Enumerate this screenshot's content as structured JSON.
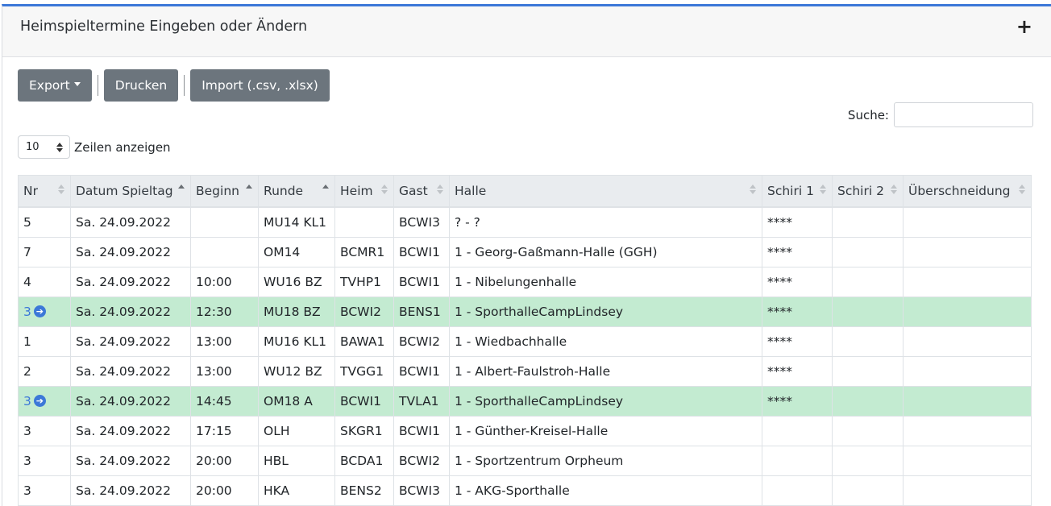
{
  "card": {
    "title": "Heimspieltermine Eingeben oder Ändern",
    "toggle_icon": "+"
  },
  "toolbar": {
    "export_label": "Export",
    "print_label": "Drucken",
    "import_label": "Import (.csv, .xlsx)"
  },
  "search": {
    "label": "Suche:",
    "value": ""
  },
  "length": {
    "value": "10",
    "label": "Zeilen anzeigen"
  },
  "accent_color": "#3c78d8",
  "highlight_color": "#c3ebd1",
  "table": {
    "headers": [
      "Nr",
      "Datum Spieltag",
      "Beginn",
      "Runde",
      "Heim",
      "Gast",
      "Halle",
      "Schiri 1",
      "Schiri 2",
      "Überschneidung"
    ],
    "rows": [
      {
        "nr": "5",
        "datum": "Sa. 24.09.2022",
        "beginn": "",
        "runde": "MU14 KL1",
        "heim": "",
        "gast": "BCWI3",
        "halle": "? - ?",
        "schiri1": "****",
        "schiri2": "",
        "ueber": "",
        "highlight": false
      },
      {
        "nr": "7",
        "datum": "Sa. 24.09.2022",
        "beginn": "",
        "runde": "OM14",
        "heim": "BCMR1",
        "gast": "BCWI1",
        "halle": "1 - Georg-Gaßmann-Halle (GGH)",
        "schiri1": "****",
        "schiri2": "",
        "ueber": "",
        "highlight": false
      },
      {
        "nr": "4",
        "datum": "Sa. 24.09.2022",
        "beginn": "10:00",
        "runde": "WU16 BZ",
        "heim": "TVHP1",
        "gast": "BCWI1",
        "halle": "1 - Nibelungenhalle",
        "schiri1": "****",
        "schiri2": "",
        "ueber": "",
        "highlight": false
      },
      {
        "nr": "3",
        "datum": "Sa. 24.09.2022",
        "beginn": "12:30",
        "runde": "MU18 BZ",
        "heim": "BCWI2",
        "gast": "BENS1",
        "halle": "1 - SporthalleCampLindsey",
        "schiri1": "****",
        "schiri2": "",
        "ueber": "",
        "highlight": true
      },
      {
        "nr": "1",
        "datum": "Sa. 24.09.2022",
        "beginn": "13:00",
        "runde": "MU16 KL1",
        "heim": "BAWA1",
        "gast": "BCWI2",
        "halle": "1 - Wiedbachhalle",
        "schiri1": "****",
        "schiri2": "",
        "ueber": "",
        "highlight": false
      },
      {
        "nr": "2",
        "datum": "Sa. 24.09.2022",
        "beginn": "13:00",
        "runde": "WU12 BZ",
        "heim": "TVGG1",
        "gast": "BCWI1",
        "halle": "1 - Albert-Faulstroh-Halle",
        "schiri1": "****",
        "schiri2": "",
        "ueber": "",
        "highlight": false
      },
      {
        "nr": "3",
        "datum": "Sa. 24.09.2022",
        "beginn": "14:45",
        "runde": "OM18 A",
        "heim": "BCWI1",
        "gast": "TVLA1",
        "halle": "1 - SporthalleCampLindsey",
        "schiri1": "****",
        "schiri2": "",
        "ueber": "",
        "highlight": true
      },
      {
        "nr": "3",
        "datum": "Sa. 24.09.2022",
        "beginn": "17:15",
        "runde": "OLH",
        "heim": "SKGR1",
        "gast": "BCWI1",
        "halle": "1 - Günther-Kreisel-Halle",
        "schiri1": "",
        "schiri2": "",
        "ueber": "",
        "highlight": false
      },
      {
        "nr": "3",
        "datum": "Sa. 24.09.2022",
        "beginn": "20:00",
        "runde": "HBL",
        "heim": "BCDA1",
        "gast": "BCWI2",
        "halle": "1 - Sportzentrum Orpheum",
        "schiri1": "",
        "schiri2": "",
        "ueber": "",
        "highlight": false
      },
      {
        "nr": "3",
        "datum": "Sa. 24.09.2022",
        "beginn": "20:00",
        "runde": "HKA",
        "heim": "BENS2",
        "gast": "BCWI3",
        "halle": "1 - AKG-Sporthalle",
        "schiri1": "",
        "schiri2": "",
        "ueber": "",
        "highlight": false
      }
    ]
  }
}
